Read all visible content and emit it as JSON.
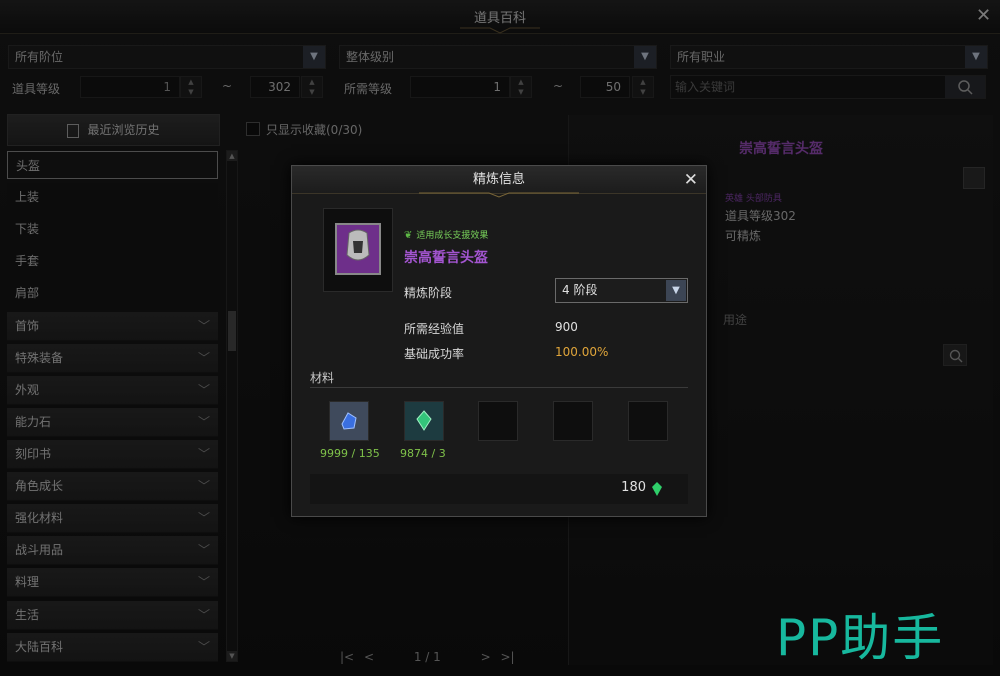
{
  "window": {
    "title": "道具百科"
  },
  "filters": {
    "tier": "所有阶位",
    "level_type": "整体级别",
    "job": "所有职业",
    "item_level_label": "道具等级",
    "item_level_min": "1",
    "item_level_max": "302",
    "req_level_label": "所需等级",
    "req_level_min": "1",
    "req_level_max": "50",
    "tilde": "~",
    "search_placeholder": "输入关键词"
  },
  "sidebar": {
    "history_label": "最近浏览历史",
    "sub_items": [
      "头盔",
      "上装",
      "下装",
      "手套",
      "肩部"
    ],
    "categories": [
      "首饰",
      "特殊装备",
      "外观",
      "能力石",
      "刻印书",
      "角色成长",
      "强化材料",
      "战斗用品",
      "料理",
      "生活",
      "大陆百科"
    ]
  },
  "middle": {
    "favorites_label": "只显示收藏(0/30)",
    "pager": "1 / 1"
  },
  "detail": {
    "title": "崇高誓言头盔",
    "tag": "英雄 头部防具",
    "item_level": "道具等级302",
    "refinable": "可精炼",
    "tab": "用途"
  },
  "modal": {
    "title": "精炼信息",
    "growth_badge": "适用成长支援效果",
    "item_name": "崇高誓言头盔",
    "stage_label": "精炼阶段",
    "stage_value": "4 阶段",
    "exp_label": "所需经验值",
    "exp_value": "900",
    "rate_label": "基础成功率",
    "rate_value": "100.00%",
    "materials_label": "材料",
    "materials": [
      {
        "qty": "9999 / 135",
        "icon": "blue-stone-icon"
      },
      {
        "qty": "9874 / 3",
        "icon": "green-crystal-icon"
      }
    ],
    "cost": "180",
    "colors": {
      "item_purple": "#a355d0",
      "growth_green": "#78d05a",
      "rate_gold": "#e0a53a",
      "qty_green": "#7fc24a"
    }
  },
  "watermark": "PP助手"
}
